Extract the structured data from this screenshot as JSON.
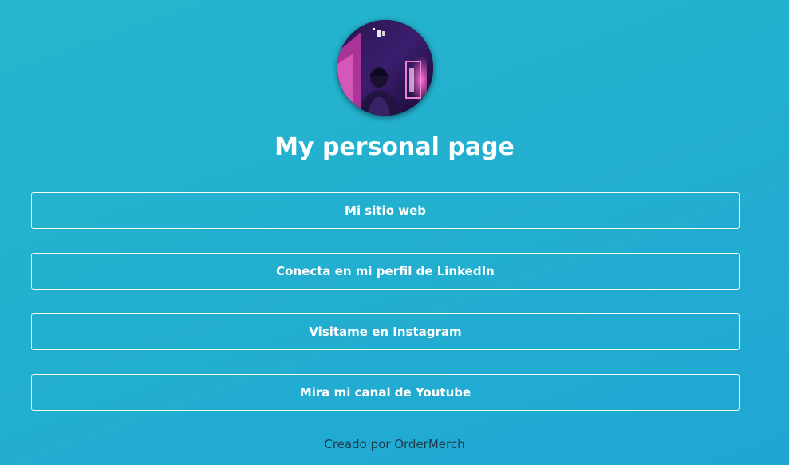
{
  "profile": {
    "title": "My personal page",
    "avatar_alt": "profile photo"
  },
  "links": [
    {
      "label": "Mi sitio web"
    },
    {
      "label": "Conecta en mi perfil de LinkedIn"
    },
    {
      "label": "Visitame en Instagram"
    },
    {
      "label": "Mira mi canal de Youtube"
    }
  ],
  "footer": {
    "text": "Creado por OrderMerch"
  },
  "colors": {
    "background_start": "#25b6cc",
    "background_end": "#1fa6d3",
    "text": "#ffffff",
    "footer_text": "#1d3a4a"
  }
}
